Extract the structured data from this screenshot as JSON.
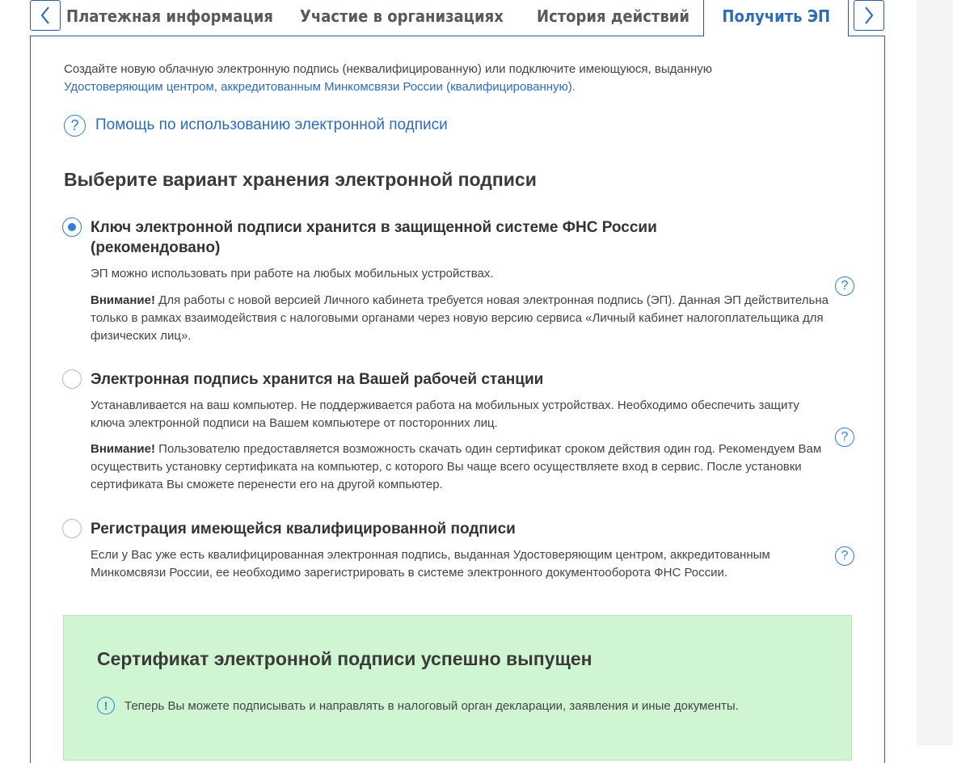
{
  "tabs": {
    "prev_label": "‹",
    "next_label": "›",
    "items": [
      {
        "label": "Платежная информация"
      },
      {
        "label": "Участие в организациях"
      },
      {
        "label": "История действий"
      },
      {
        "label": "Получить ЭП",
        "active": true
      }
    ]
  },
  "intro": {
    "text": "Создайте новую облачную электронную подпись (неквалифицированную) или подключите имеющуюся, выданную",
    "link": "Удостоверяющим центром, аккредитованным Минкомсвязи России (квалифицированную)."
  },
  "help_link": {
    "icon": "?",
    "label": "Помощь по использованию электронной подписи"
  },
  "section_title": "Выберите вариант хранения электронной подписи",
  "options": [
    {
      "title": "Ключ электронной подписи хранится в защищенной системе ФНС России (рекомендовано)",
      "selected": true,
      "text": "ЭП можно использовать при работе на любых мобильных устройствах.",
      "warning_label": "Внимание!",
      "warning_text": "Для работы с новой версией Личного кабинета требуется новая электронная подпись (ЭП). Данная ЭП действительна только в рамках взаимодействия с налоговыми органами через новую версию сервиса «Личный кабинет налогоплательщика для физических лиц».",
      "help_icon": "?"
    },
    {
      "title": "Электронная подпись хранится на Вашей рабочей станции",
      "selected": false,
      "text": "Устанавливается на ваш компьютер. Не поддерживается работа на мобильных устройствах. Необходимо обеспечить защиту ключа электронной подписи на Вашем компьютере от посторонних лиц.",
      "warning_label": "Внимание!",
      "warning_text": "Пользователю предоставляется возможность скачать один сертификат сроком действия один год. Рекомендуем Вам осуществить установку сертификата на компьютер, с которого Вы чаще всего осуществляете вход в сервис. После установки сертификата Вы сможете перенести его на другой компьютер.",
      "help_icon": "?"
    },
    {
      "title": "Регистрация имеющейся квалифицированной подписи",
      "selected": false,
      "text": "Если у Вас уже есть квалифицированная электронная подпись, выданная Удостоверяющим центром, аккредитованным Минкомсвязи России, ее необходимо зарегистрировать в системе электронного документооборота ФНС России.",
      "help_icon": "?"
    }
  ],
  "success": {
    "title": "Сертификат электронной подписи успешно выпущен",
    "icon": "!",
    "text": "Теперь Вы можете подписывать и направлять в налоговый орган декларации, заявления и иные документы."
  },
  "colors": {
    "accent": "#2e6db5",
    "border": "#2e5c9c",
    "success_bg": "#d0f5d3",
    "radio_on": "#2e7fd0"
  },
  "icons": {
    "prev": "chevron-left-icon",
    "next": "chevron-right-icon",
    "help": "question-circle-icon",
    "info": "exclamation-circle-icon"
  }
}
